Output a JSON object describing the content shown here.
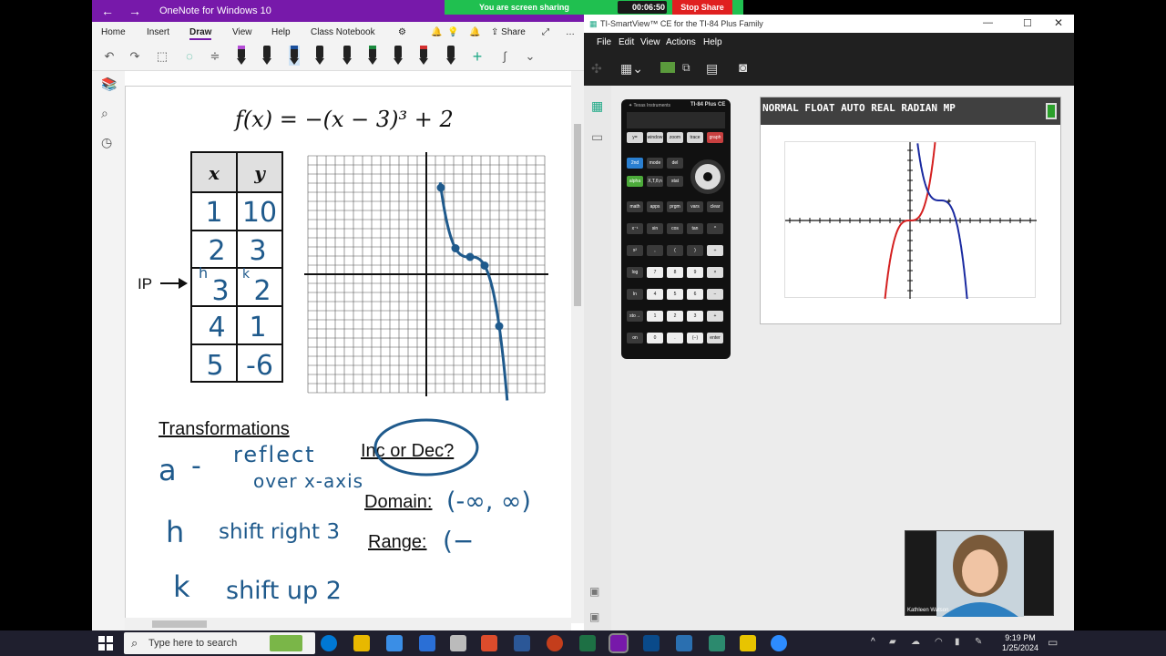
{
  "onenote": {
    "title": "OneNote for Windows 10",
    "menu": [
      "Home",
      "Insert",
      "Draw",
      "View",
      "Help",
      "Class Notebook"
    ],
    "active_menu": "Draw",
    "share_label": "Share",
    "page": {
      "function": "f(x) = −(x − 3)³ + 2",
      "table": {
        "headers": [
          "x",
          "y"
        ],
        "rows": [
          [
            "1",
            "10"
          ],
          [
            "2",
            "3"
          ],
          [
            "3",
            "2"
          ],
          [
            "4",
            "1"
          ],
          [
            "5",
            "-6"
          ]
        ],
        "h_mark": "h",
        "k_mark": "k"
      },
      "ip_label": "IP",
      "transformations_title": "Transformations",
      "notes": [
        {
          "key": "a",
          "text": "reflect",
          "text2": "over x-axis"
        },
        {
          "key": "h",
          "text": "shift right 3"
        },
        {
          "key": "k",
          "text": "shift up 2"
        }
      ],
      "inc_dec": "Inc or Dec?",
      "domain_label": "Domain:",
      "domain_value": "(-∞, ∞)",
      "range_label": "Range:",
      "range_value": "(−"
    }
  },
  "zoom": {
    "sharing_text": "You are screen sharing",
    "timer": "00:06:50",
    "stop_label": "Stop Share"
  },
  "ti": {
    "title": "TI-SmartView™ CE for the TI-84 Plus Family",
    "menu": [
      "File",
      "Edit",
      "View",
      "Actions",
      "Help"
    ],
    "brand": "TI-84 Plus CE",
    "status": "NORMAL FLOAT AUTO REAL RADIAN MP",
    "keys": [
      [
        "y=",
        "window",
        "zoom",
        "trace",
        "graph"
      ],
      [
        "2nd",
        "mode",
        "del"
      ],
      [
        "alpha",
        "X,T,θ,n",
        "stat"
      ],
      [
        "math",
        "apps",
        "prgm",
        "vars",
        "clear"
      ],
      [
        "x⁻¹",
        "sin",
        "cos",
        "tan",
        "^"
      ],
      [
        "x²",
        ",",
        "(",
        ")",
        "÷"
      ],
      [
        "log",
        "7",
        "8",
        "9",
        "×"
      ],
      [
        "ln",
        "4",
        "5",
        "6",
        "−"
      ],
      [
        "sto→",
        "1",
        "2",
        "3",
        "+"
      ],
      [
        "on",
        "0",
        ".",
        "(−)",
        "enter"
      ]
    ]
  },
  "webcam": {
    "name": "Kathleen Watson"
  },
  "taskbar": {
    "search_placeholder": "Type here to search",
    "time": "9:19 PM",
    "date": "1/25/2024"
  }
}
